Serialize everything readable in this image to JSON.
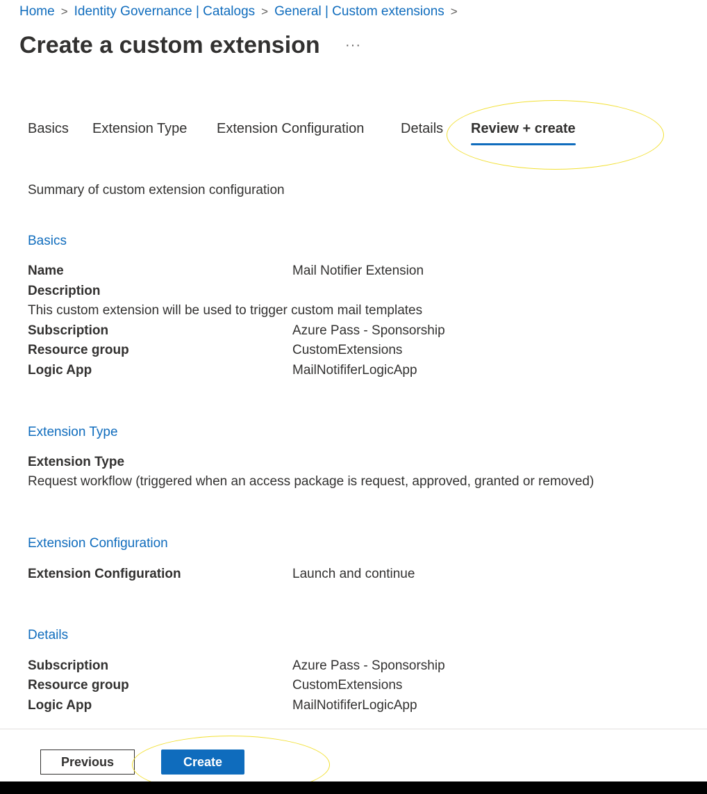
{
  "breadcrumb": {
    "items": [
      "Home",
      "Identity Governance | Catalogs",
      "General | Custom extensions"
    ],
    "separator": ">"
  },
  "page": {
    "title": "Create a custom extension",
    "more": "···"
  },
  "tabs": [
    {
      "label": "Basics",
      "active": false
    },
    {
      "label": "Extension Type",
      "active": false
    },
    {
      "label": "Extension Configuration",
      "active": false
    },
    {
      "label": "Details",
      "active": false
    },
    {
      "label": "Review + create",
      "active": true
    }
  ],
  "summary": "Summary of custom extension configuration",
  "sections": {
    "basics": {
      "title": "Basics",
      "name_label": "Name",
      "name_value": "Mail Notifier Extension",
      "description_label": "Description",
      "description_value": "This custom extension will be used to trigger custom mail templates",
      "subscription_label": "Subscription",
      "subscription_value": "Azure Pass - Sponsorship",
      "resource_group_label": "Resource group",
      "resource_group_value": "CustomExtensions",
      "logic_app_label": "Logic App",
      "logic_app_value": "MailNotififerLogicApp"
    },
    "extension_type": {
      "title": "Extension Type",
      "label": "Extension Type",
      "value": "Request workflow (triggered when an access package is request, approved, granted or removed)"
    },
    "extension_configuration": {
      "title": "Extension Configuration",
      "label": "Extension Configuration",
      "value": "Launch and continue"
    },
    "details": {
      "title": "Details",
      "subscription_label": "Subscription",
      "subscription_value": "Azure Pass - Sponsorship",
      "resource_group_label": "Resource group",
      "resource_group_value": "CustomExtensions",
      "logic_app_label": "Logic App",
      "logic_app_value": "MailNotififerLogicApp"
    }
  },
  "footer": {
    "previous_label": "Previous",
    "create_label": "Create"
  },
  "colors": {
    "accent": "#0f6cbd",
    "highlight": "#f2e033",
    "text": "#323130"
  }
}
